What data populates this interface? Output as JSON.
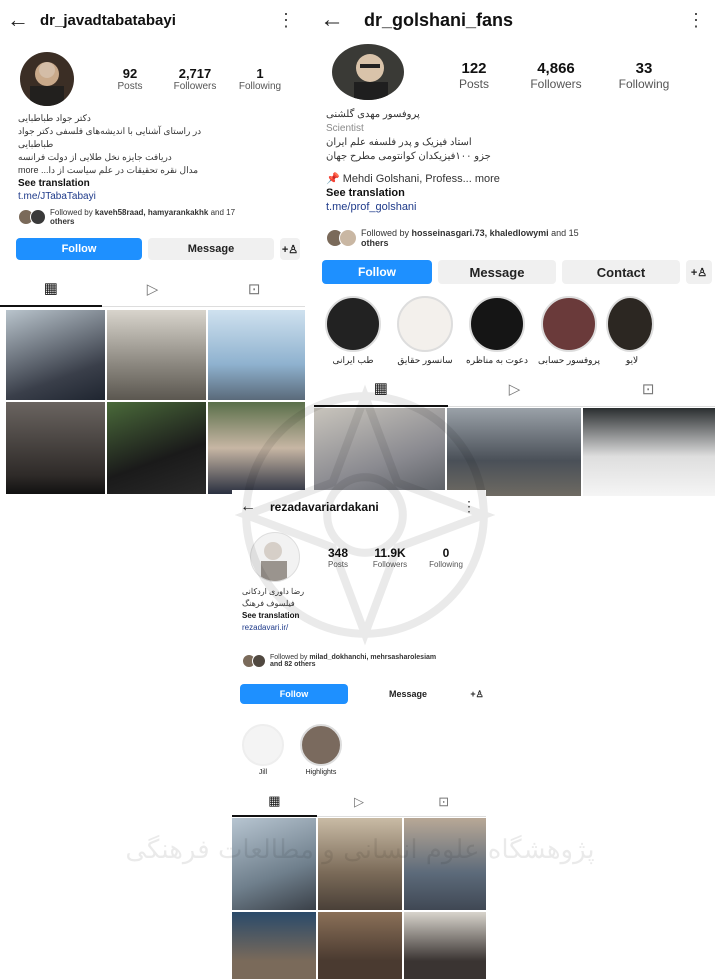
{
  "profiles": [
    {
      "username": "dr_javadtabatabayi",
      "stats": [
        {
          "n": "92",
          "l": "Posts"
        },
        {
          "n": "2,717",
          "l": "Followers"
        },
        {
          "n": "1",
          "l": "Following"
        }
      ],
      "bio_name": "دکتر جواد طباطبایی",
      "bio_lines": [
        "در راستای آشنایی با اندیشه‌های فلسفی دکتر جواد طباطبایی",
        "دریافت جایزه نخل طلایی از دولت فرانسه",
        "مدال نقره تحقیقات در علم سیاست از دا... more"
      ],
      "see_translation": "See translation",
      "link": "t.me/JTabaTabayi",
      "followed_by_prefix": "Followed by",
      "followed_by_names": "kaveh58raad, hamyarankakhk",
      "followed_by_suffix": "and 17",
      "followed_by_others": "others",
      "follow": "Follow",
      "message": "Message",
      "add_icon": "+person"
    },
    {
      "username": "dr_golshani_fans",
      "stats": [
        {
          "n": "122",
          "l": "Posts"
        },
        {
          "n": "4,866",
          "l": "Followers"
        },
        {
          "n": "33",
          "l": "Following"
        }
      ],
      "bio_name": "پروفسور مهدی گلشنی",
      "category": "Scientist",
      "bio_lines": [
        "استاد فیزیک و پدر فلسفه علم ایران",
        "جزو ۱۰۰فیزیکدان کوانتومی مطرح جهان"
      ],
      "mention": "Mehdi Golshani, Profess... more",
      "see_translation": "See translation",
      "link": "t.me/prof_golshani",
      "followed_by_prefix": "Followed by",
      "followed_by_names": "hosseinasgari.73, khaledlowymi",
      "followed_by_suffix": "and 15",
      "followed_by_others": "others",
      "follow": "Follow",
      "message": "Message",
      "contact": "Contact",
      "add_icon": "+person",
      "highlights": [
        "طب ایرانی",
        "سانسور حقایق",
        "دعوت به مناظره",
        "پروفسور حسابی",
        "لایو"
      ]
    },
    {
      "username": "rezadavariardakani",
      "stats": [
        {
          "n": "348",
          "l": "Posts"
        },
        {
          "n": "11.9K",
          "l": "Followers"
        },
        {
          "n": "0",
          "l": "Following"
        }
      ],
      "bio_name": "رضا داوری اردکانی",
      "bio_lines": [
        "فیلسوف فرهنگ"
      ],
      "see_translation": "See translation",
      "link": "rezadavari.ir/",
      "followed_by_prefix": "Followed by",
      "followed_by_names": "milad_dokhanchi, mehrsasharolesiam",
      "followed_by_suffix": "and 82 others",
      "follow": "Follow",
      "message": "Message",
      "add_icon": "+person",
      "highlights": [
        "Jill",
        "Highlights"
      ]
    }
  ],
  "watermark_text": "پژوهشگاه علوم انسانی و مطالعات فرهنگی",
  "icons": {
    "back": "arrow-left-icon",
    "more": "kebab-icon",
    "grid": "grid-icon",
    "reels": "play-icon",
    "tagged": "tagged-icon"
  }
}
